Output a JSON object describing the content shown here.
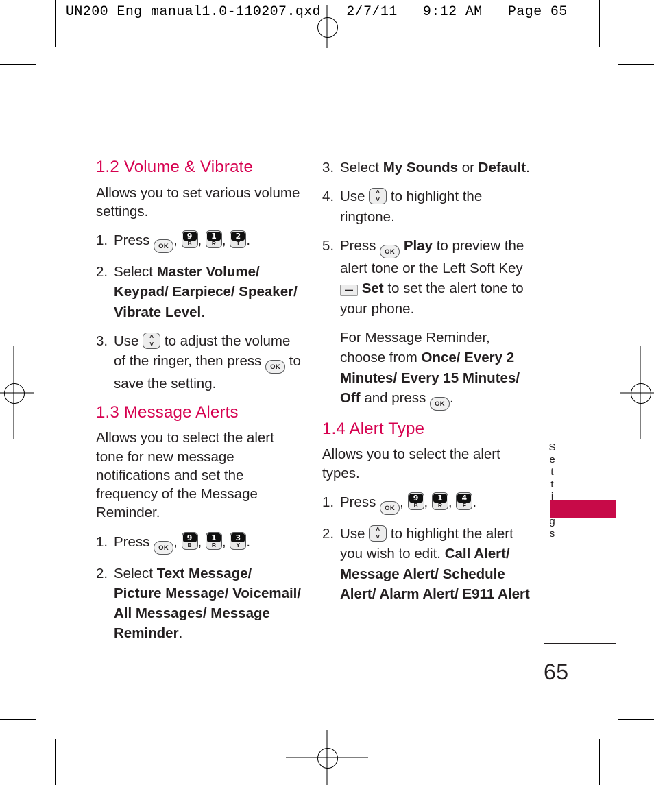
{
  "print_marks": {
    "slug": "UN200_Eng_manual1.0-110207.qxd   2/7/11   9:12 AM   Page 65"
  },
  "colors": {
    "heading": "#D6004F",
    "tab": "#C70A48",
    "text": "#231f20"
  },
  "icons": {
    "ok": {
      "label": "OK"
    },
    "key_9b": {
      "digit": "9",
      "letter": "B"
    },
    "key_1r": {
      "digit": "1",
      "letter": "R"
    },
    "key_2t": {
      "digit": "2",
      "letter": "T"
    },
    "key_3y": {
      "digit": "3",
      "letter": "Y"
    },
    "key_4f": {
      "digit": "4",
      "letter": "F"
    },
    "nav": {
      "up": "˄",
      "down": "˅"
    },
    "soft_key": {
      "glyph": "–"
    }
  },
  "left_column": {
    "section_1_2": {
      "heading": "1.2 Volume & Vibrate",
      "intro": "Allows you to set various volume settings.",
      "steps": [
        {
          "num": "1.",
          "lead": "Press",
          "trail": "."
        },
        {
          "num": "2.",
          "lead": "Select",
          "bold": "Master Volume/ Keypad/ Earpiece/ Speaker/ Vibrate Level",
          "trail": "."
        },
        {
          "num": "3.",
          "lead": "Use",
          "mid": "to adjust the volume of the ringer, then press",
          "trail": "to save the setting."
        }
      ]
    },
    "section_1_3": {
      "heading": "1.3 Message Alerts",
      "intro": "Allows you to select the alert tone for new message notifications and set the frequency of the Message Reminder.",
      "steps": [
        {
          "num": "1.",
          "lead": "Press",
          "trail": "."
        },
        {
          "num": "2.",
          "lead": "Select",
          "bold": "Text Message/ Picture Message/ Voicemail/ All Messages/ Message Reminder",
          "trail": "."
        }
      ]
    }
  },
  "right_column": {
    "continued_steps": [
      {
        "num": "3.",
        "lead": "Select",
        "bold1": "My Sounds",
        "mid": "or",
        "bold2": "Default",
        "trail": "."
      },
      {
        "num": "4.",
        "lead": "Use",
        "mid": "to highlight the ringtone."
      },
      {
        "num": "5.",
        "lead": "Press",
        "bold1": "Play",
        "mid": "to preview the alert tone or the Left Soft Key",
        "bold2": "Set",
        "trail": "to set the alert tone to your phone."
      }
    ],
    "reminder_note": {
      "lead": "For Message Reminder, choose from",
      "bold": "Once/ Every 2 Minutes/ Every 15 Minutes/ Off",
      "mid": "and press",
      "trail": "."
    },
    "section_1_4": {
      "heading": "1.4 Alert Type",
      "intro": "Allows you to select the alert types.",
      "steps": [
        {
          "num": "1.",
          "lead": "Press",
          "trail": "."
        },
        {
          "num": "2.",
          "lead": "Use",
          "mid": "to highlight the alert you wish to edit.",
          "bold": "Call Alert/ Message Alert/ Schedule Alert/ Alarm Alert/ E911 Alert"
        }
      ]
    }
  },
  "side_tab": {
    "label": "Settings"
  },
  "footer": {
    "page_number": "65"
  }
}
